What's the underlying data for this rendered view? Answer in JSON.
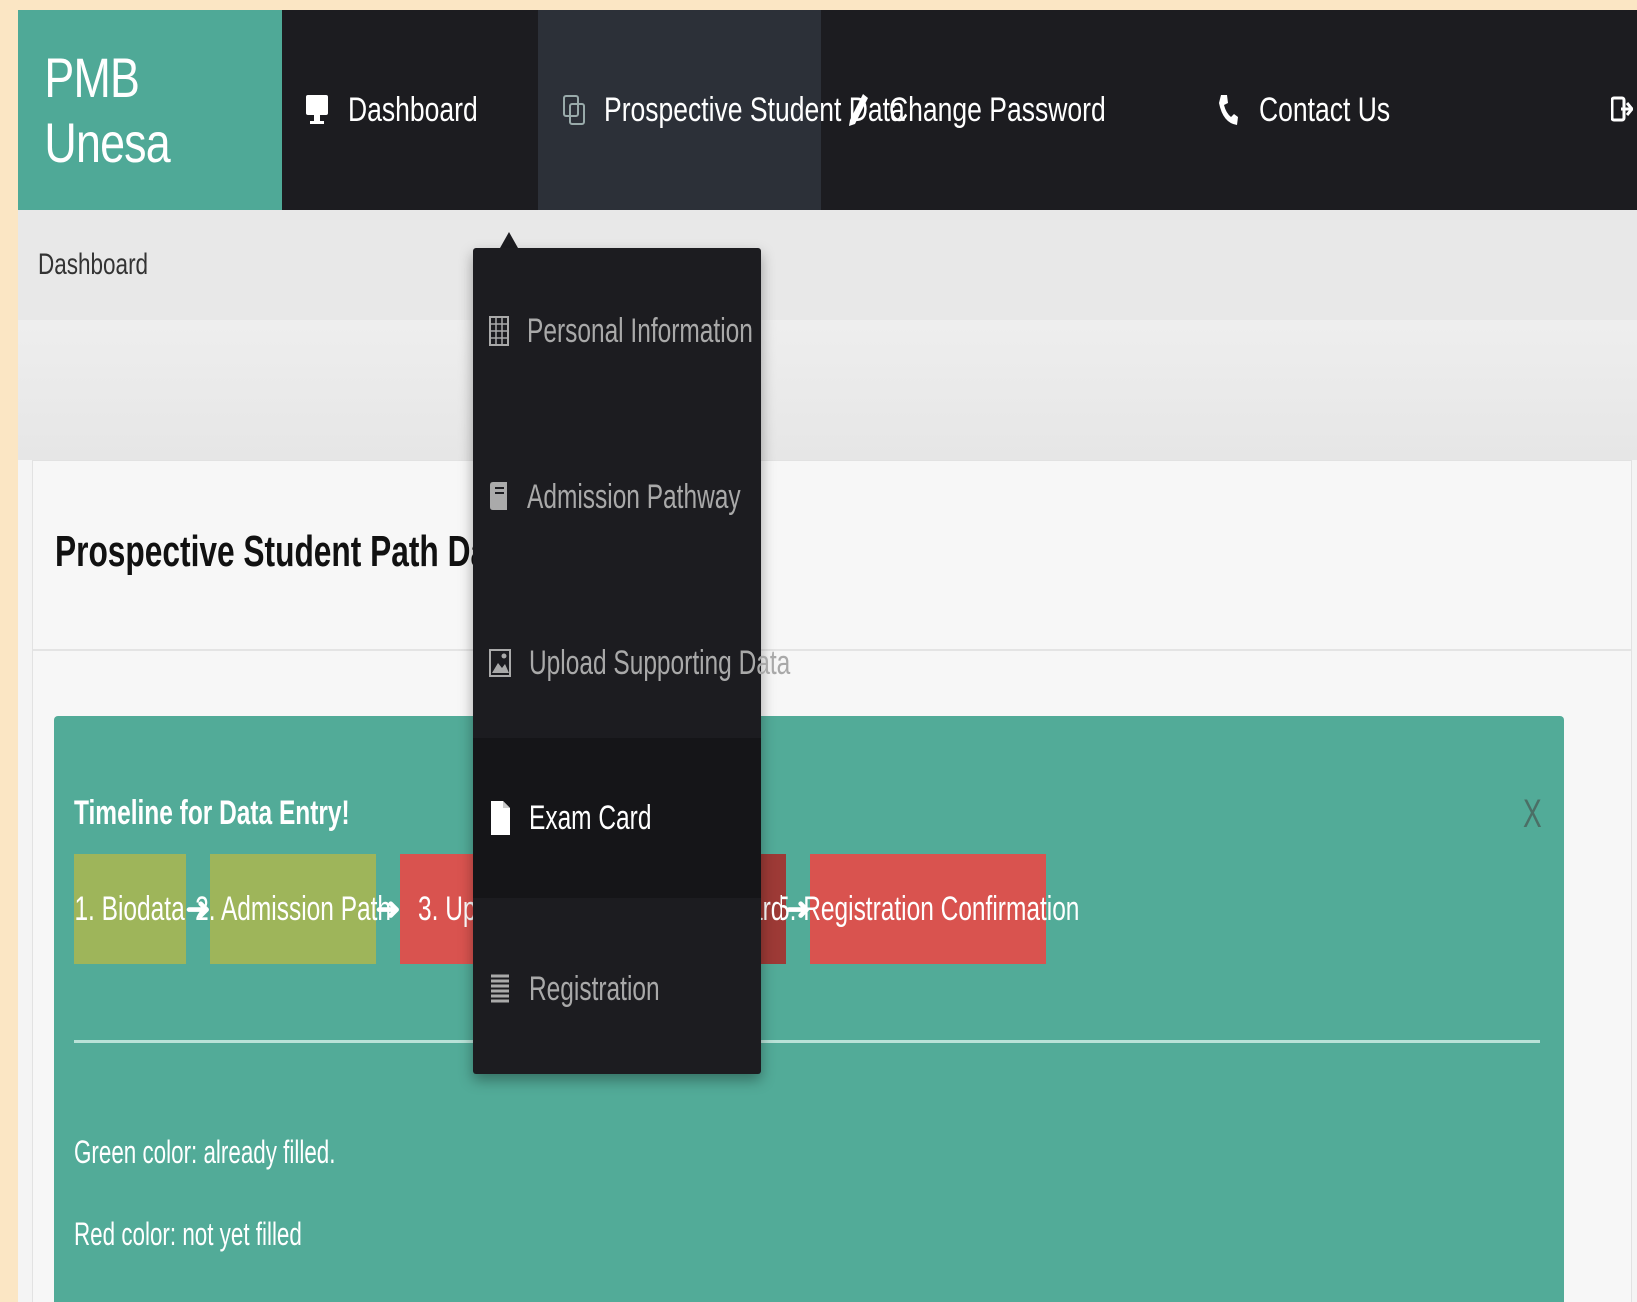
{
  "brand": "PMB Unesa",
  "nav": {
    "dashboard": "Dashboard",
    "student_data": "Prospective Student Data",
    "change_password": "Change Password",
    "contact": "Contact Us"
  },
  "breadcrumb": "Dashboard",
  "dropdown": {
    "items": [
      {
        "label": "Personal Information",
        "icon": "table-icon"
      },
      {
        "label": "Admission Pathway",
        "icon": "book-icon"
      },
      {
        "label": "Upload Supporting Data",
        "icon": "image-icon"
      },
      {
        "label": "Exam Card",
        "icon": "file-icon"
      },
      {
        "label": "Registration",
        "icon": "list-icon"
      }
    ]
  },
  "panel": {
    "title": "Prospective Student Path Data"
  },
  "alert": {
    "title": "Timeline for Data Entry!",
    "close": "X",
    "steps": [
      {
        "label": "1. Biodata",
        "status": "green"
      },
      {
        "label": "2. Admission Path",
        "status": "green"
      },
      {
        "label": "3. Up",
        "status": "red"
      },
      {
        "label": "ard",
        "status": "darkred"
      },
      {
        "label": "5. Registration Confirmation",
        "status": "red"
      }
    ],
    "legend_green": "Green color: already filled.",
    "legend_red": "Red color: not yet filled"
  },
  "colors": {
    "brand": "#4fa997",
    "navbar": "#1c1c20",
    "alert": "#52ab98",
    "green_step": "#9eb55a",
    "red_step": "#d9534f"
  }
}
